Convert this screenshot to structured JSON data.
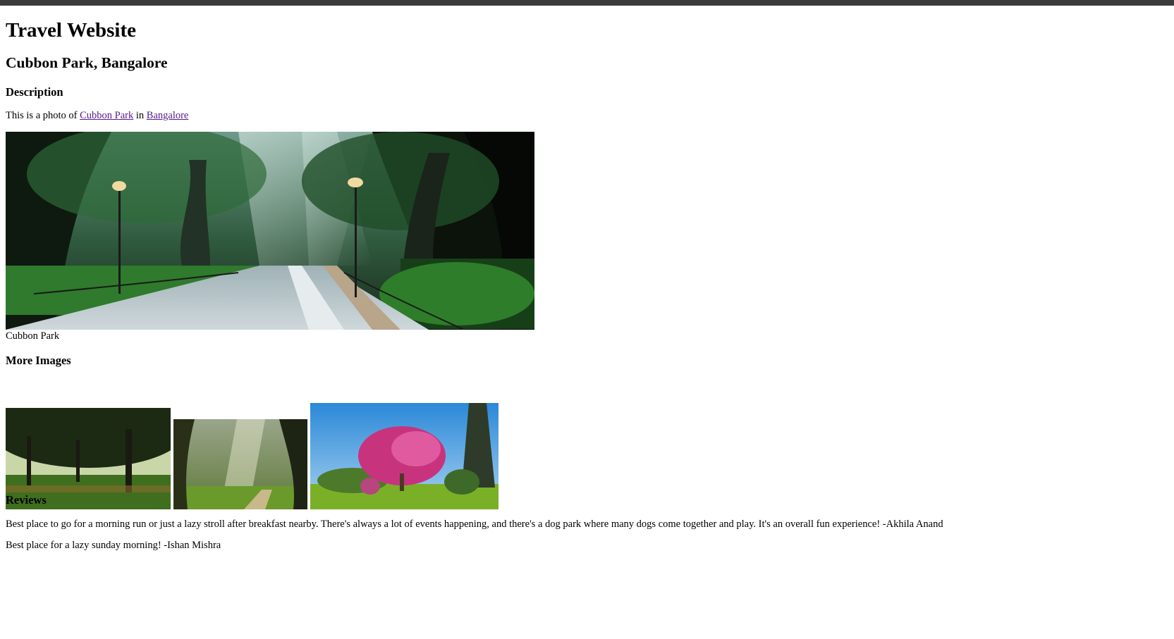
{
  "page": {
    "title": "Travel Website",
    "place_title": "Cubbon Park, Bangalore"
  },
  "description": {
    "heading": "Description",
    "text_prefix": "This is a photo of ",
    "link1": "Cubbon Park",
    "text_middle": " in ",
    "link2": "Bangalore"
  },
  "main_image": {
    "caption": "Cubbon Park"
  },
  "more_images": {
    "heading": "More Images"
  },
  "reviews": {
    "heading": "Reviews",
    "items": [
      "Best place to go for a morning run or just a lazy stroll after breakfast nearby. There's always a lot of events happening, and there's a dog park where many dogs come together and play. It's an overall fun experience! -Akhila Anand",
      "Best place for a lazy sunday morning! -Ishan Mishra"
    ]
  },
  "colors": {
    "link": "#551a8b",
    "topbar": "#3b3b3b"
  }
}
